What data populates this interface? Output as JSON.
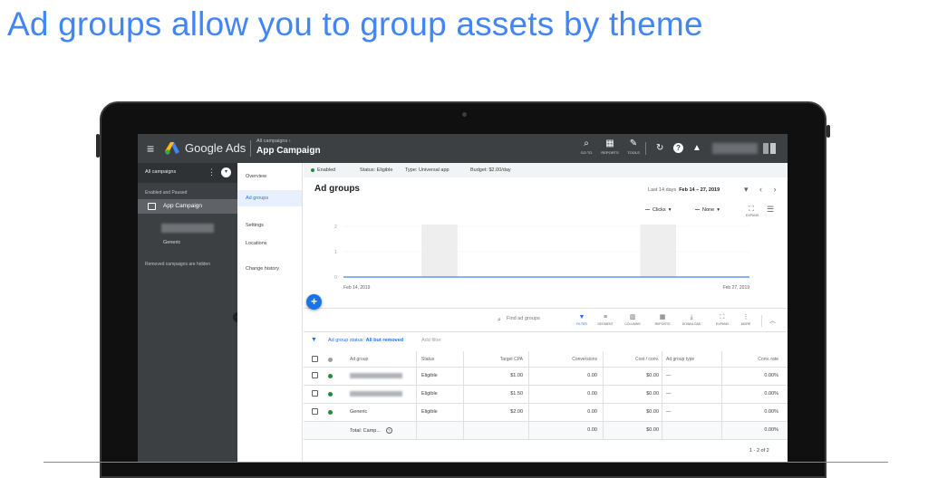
{
  "slide": {
    "title": "Ad groups allow you to group assets by theme"
  },
  "topbar": {
    "brand": "Google Ads",
    "breadcrumb": "All campaigns  ›",
    "campaign_title": "App Campaign",
    "goto_label": "GO TO",
    "reports_label": "REPORTS",
    "tools_label": "TOOLS"
  },
  "sidenav": {
    "header": "All campaigns",
    "section_label": "Enabled and Paused",
    "campaign": "App Campaign",
    "adgroup": "Generic",
    "removed_note": "Removed campaigns are hidden"
  },
  "pagenav": {
    "items": [
      "Overview",
      "Ad groups",
      "Settings",
      "Locations",
      "Change history"
    ],
    "active_index": 1
  },
  "statusbar": {
    "enabled": "Enabled",
    "status": "Status: Eligible",
    "type": "Type: Universal app",
    "budget": "Budget: $2.00/day"
  },
  "page": {
    "title": "Ad groups",
    "date_label": "Last 14 days",
    "date_value": "Feb 14 – 27, 2019",
    "date_arrows": "▾ ‹ ›"
  },
  "metrics": {
    "primary": "Clicks",
    "secondary": "None",
    "expand_label": "EXPAND",
    "primary_color": "#4285f4",
    "secondary_color": "#ea4335"
  },
  "chart_data": {
    "type": "line",
    "x_start": "Feb 14, 2019",
    "x_end": "Feb 27, 2019",
    "y_ticks": [
      "2",
      "1",
      "0"
    ],
    "ylim": [
      0,
      2
    ],
    "series": [
      {
        "name": "Clicks",
        "values": [
          0,
          0,
          0,
          0,
          0,
          0,
          0,
          0,
          0,
          0,
          0,
          0,
          0,
          0
        ],
        "color": "#4285f4"
      }
    ],
    "shaded_days": [
      3,
      10
    ]
  },
  "toolbar": {
    "search_placeholder": "Find ad groups",
    "tools": [
      {
        "icon": "filter-icon",
        "label": "FILTER"
      },
      {
        "icon": "segment-icon",
        "label": "SEGMENT"
      },
      {
        "icon": "columns-icon",
        "label": "COLUMNS"
      },
      {
        "icon": "reports-icon",
        "label": "REPORTS"
      },
      {
        "icon": "download-icon",
        "label": "DOWNLOAD"
      },
      {
        "icon": "expand-icon",
        "label": "EXPAND"
      },
      {
        "icon": "more-icon",
        "label": "MORE"
      }
    ]
  },
  "filter": {
    "prefix": "Ad group status: ",
    "value": "All but removed",
    "add": "Add filter"
  },
  "table": {
    "headers": [
      "Ad group",
      "Status",
      "Target CPA",
      "Conversions",
      "Cost / conv.",
      "Ad group type",
      "Conv. rate"
    ],
    "rows": [
      {
        "name": "",
        "status": "Eligible",
        "cpa": "$1.00",
        "conversions": "0.00",
        "cost": "$0.00",
        "type": "—",
        "rate": "0.00%"
      },
      {
        "name": "",
        "status": "Eligible",
        "cpa": "$1.50",
        "conversions": "0.00",
        "cost": "$0.00",
        "type": "—",
        "rate": "0.00%"
      },
      {
        "name": "Generic",
        "status": "Eligible",
        "cpa": "$2.00",
        "conversions": "0.00",
        "cost": "$0.00",
        "type": "—",
        "rate": "0.00%"
      }
    ],
    "total": {
      "label": "Total: Camp...",
      "conversions": "0.00",
      "cost": "$0.00",
      "rate": "0.00%"
    },
    "pager": "1 - 2 of 2"
  }
}
